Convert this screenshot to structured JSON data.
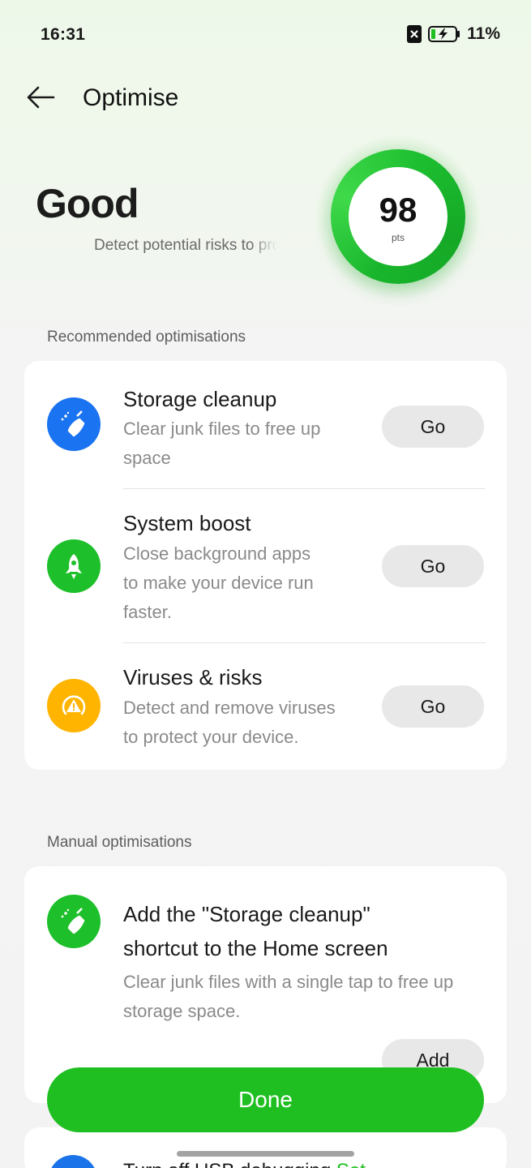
{
  "status_bar": {
    "time": "16:31",
    "battery": "11%"
  },
  "header": {
    "title": "Optimise"
  },
  "hero": {
    "status": "Good",
    "subtitle": "Detect potential risks to protect your device",
    "score": "98",
    "score_unit": "pts",
    "score_level": 0.98
  },
  "recommended": {
    "label": "Recommended optimisations",
    "items": [
      {
        "title": "Storage cleanup",
        "desc_lines": [
          "Clear junk files to free up",
          "space"
        ],
        "action": "Go",
        "icon": "broom-icon",
        "color": "#1a73f0"
      },
      {
        "title": "System boost",
        "desc_lines": [
          "Close background apps",
          "to make your device run",
          "faster."
        ],
        "action": "Go",
        "icon": "rocket-icon",
        "color": "#1dbf2a"
      },
      {
        "title": "Viruses & risks",
        "desc_lines": [
          "Detect and remove viruses",
          "to protect your device."
        ],
        "action": "Go",
        "icon": "warning-shield-icon",
        "color": "#ffb400"
      }
    ]
  },
  "manual": {
    "label": "Manual optimisations",
    "items": [
      {
        "title_lines": [
          "Add the \"Storage cleanup\"",
          "shortcut to the Home screen"
        ],
        "desc_lines": [
          "Clear junk files with a single tap to free up",
          "storage space."
        ],
        "action": "Add",
        "icon": "broom-icon",
        "color": "#1dbf2a"
      }
    ],
    "peek": {
      "text": "Turn off USB debugging",
      "accent": "Set"
    }
  },
  "footer": {
    "done_label": "Done"
  },
  "colors": {
    "accent": "#1fbf22",
    "blue": "#1a73f0",
    "amber": "#ffb400"
  }
}
